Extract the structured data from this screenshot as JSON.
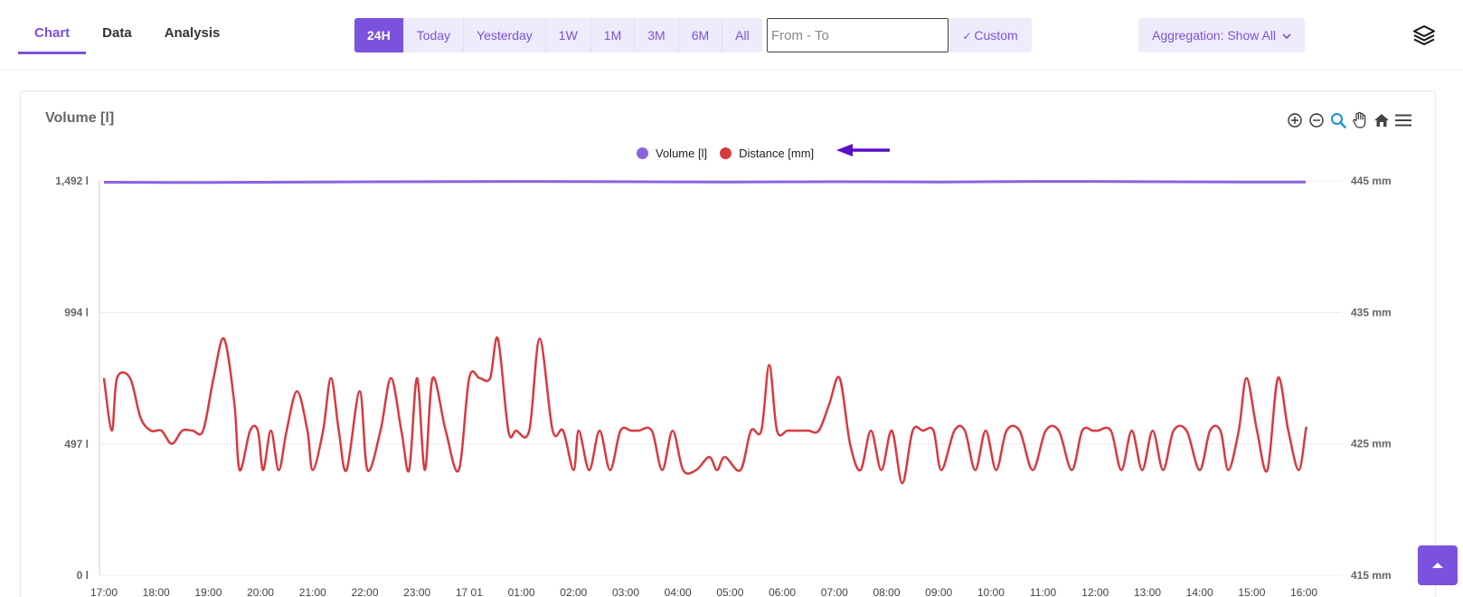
{
  "tabs": [
    {
      "label": "Chart",
      "active": true
    },
    {
      "label": "Data",
      "active": false
    },
    {
      "label": "Analysis",
      "active": false
    }
  ],
  "ranges": [
    {
      "label": "24H",
      "active": true
    },
    {
      "label": "Today"
    },
    {
      "label": "Yesterday"
    },
    {
      "label": "1W"
    },
    {
      "label": "1M"
    },
    {
      "label": "3M"
    },
    {
      "label": "6M"
    },
    {
      "label": "All"
    }
  ],
  "date_input": {
    "placeholder": "From - To",
    "value": ""
  },
  "custom_label": "Custom",
  "aggregation_label": "Aggregation: Show All",
  "icons": {
    "layers": "layers-icon",
    "zoom_in": "zoom-in-icon",
    "zoom_out": "zoom-out-icon",
    "selection_zoom": "magnifier-icon",
    "pan": "hand-icon",
    "reset": "home-icon",
    "menu": "hamburger-menu-icon",
    "scroll_top": "caret-up-icon"
  },
  "colors": {
    "accent": "#7b52dd",
    "accent_light": "#eeebfb",
    "volume": "#8a63e0",
    "distance": "#d83a3f",
    "annotation_arrow": "#5b0fc8"
  },
  "chart_data": {
    "type": "line",
    "title": "Volume [l]",
    "legend": {
      "position": "top-center",
      "entries": [
        "Volume [l]",
        "Distance [mm]"
      ]
    },
    "x_tick_labels": [
      "17:00",
      "18:00",
      "19:00",
      "20:00",
      "21:00",
      "22:00",
      "23:00",
      "17 01",
      "01:00",
      "02:00",
      "03:00",
      "04:00",
      "05:00",
      "06:00",
      "07:00",
      "08:00",
      "09:00",
      "10:00",
      "11:00",
      "12:00",
      "13:00",
      "14:00",
      "15:00",
      "16:00"
    ],
    "y_left": {
      "tick_labels": [
        "1,492 l",
        "994 l",
        "497 l",
        "0 l"
      ],
      "ticks": [
        1492,
        994,
        497,
        0
      ],
      "range": [
        0,
        1492
      ]
    },
    "y_right": {
      "tick_labels": [
        "445 mm",
        "435 mm",
        "425 mm",
        "415 mm"
      ],
      "ticks": [
        445,
        435,
        425,
        415
      ],
      "range": [
        415,
        445
      ]
    },
    "grid": true,
    "series": [
      {
        "name": "Volume [l]",
        "axis": "left",
        "x": [
          0,
          2,
          4,
          6,
          8,
          10,
          12,
          14,
          16,
          18,
          20,
          22,
          23.5
        ],
        "values": [
          1487,
          1486,
          1488,
          1489,
          1490,
          1489,
          1488,
          1489,
          1488,
          1490,
          1489,
          1488,
          1488
        ]
      },
      {
        "name": "Distance [mm]",
        "axis": "right",
        "x": [
          0,
          0.15,
          0.25,
          0.5,
          0.7,
          0.9,
          1.1,
          1.3,
          1.5,
          1.7,
          1.9,
          2.1,
          2.3,
          2.5,
          2.6,
          2.8,
          2.95,
          3.05,
          3.2,
          3.35,
          3.5,
          3.7,
          3.9,
          4.0,
          4.2,
          4.35,
          4.5,
          4.65,
          4.9,
          5.05,
          5.3,
          5.5,
          5.7,
          5.85,
          6.0,
          6.15,
          6.3,
          6.55,
          6.8,
          7.0,
          7.2,
          7.4,
          7.55,
          7.75,
          7.9,
          8.15,
          8.35,
          8.6,
          8.8,
          9.0,
          9.1,
          9.3,
          9.5,
          9.7,
          9.9,
          10.1,
          10.25,
          10.5,
          10.7,
          10.9,
          11.1,
          11.35,
          11.6,
          11.75,
          11.9,
          12.2,
          12.4,
          12.6,
          12.75,
          12.9,
          13.1,
          13.3,
          13.5,
          13.7,
          13.9,
          14.1,
          14.3,
          14.5,
          14.7,
          14.9,
          15.1,
          15.3,
          15.5,
          15.7,
          15.9,
          16.05,
          16.3,
          16.5,
          16.7,
          16.9,
          17.1,
          17.3,
          17.55,
          17.8,
          18.05,
          18.3,
          18.55,
          18.75,
          18.95,
          19.05,
          19.3,
          19.5,
          19.7,
          19.9,
          20.1,
          20.3,
          20.5,
          20.75,
          21.0,
          21.2,
          21.4,
          21.55,
          21.75,
          21.9,
          22.1,
          22.3,
          22.5,
          22.7,
          22.9,
          23.1,
          23.3,
          23.5
        ],
        "values": [
          430,
          426,
          430,
          430,
          427,
          426,
          426,
          425,
          426,
          426,
          426,
          430,
          433,
          428,
          423,
          426,
          426,
          423,
          426,
          423,
          426,
          429,
          426,
          423,
          426,
          430,
          426,
          423,
          429,
          423,
          426,
          430,
          426,
          423,
          430,
          423,
          430,
          426,
          423,
          430,
          430,
          430,
          433,
          426,
          426,
          426,
          433,
          426,
          426,
          423,
          426,
          423,
          426,
          423,
          426,
          426,
          426,
          426,
          423,
          426,
          423,
          423,
          424,
          423,
          424,
          423,
          426,
          426,
          431,
          426,
          426,
          426,
          426,
          426,
          428,
          430,
          425,
          423,
          426,
          423,
          426,
          422,
          426,
          426,
          426,
          423,
          426,
          426,
          423,
          426,
          423,
          426,
          426,
          423,
          426,
          426,
          423,
          426,
          426,
          426,
          426,
          423,
          426,
          423,
          426,
          423,
          426,
          426,
          423,
          426,
          426,
          423,
          426,
          430,
          426,
          423,
          430,
          426,
          423,
          426,
          426,
          426
        ]
      }
    ]
  }
}
